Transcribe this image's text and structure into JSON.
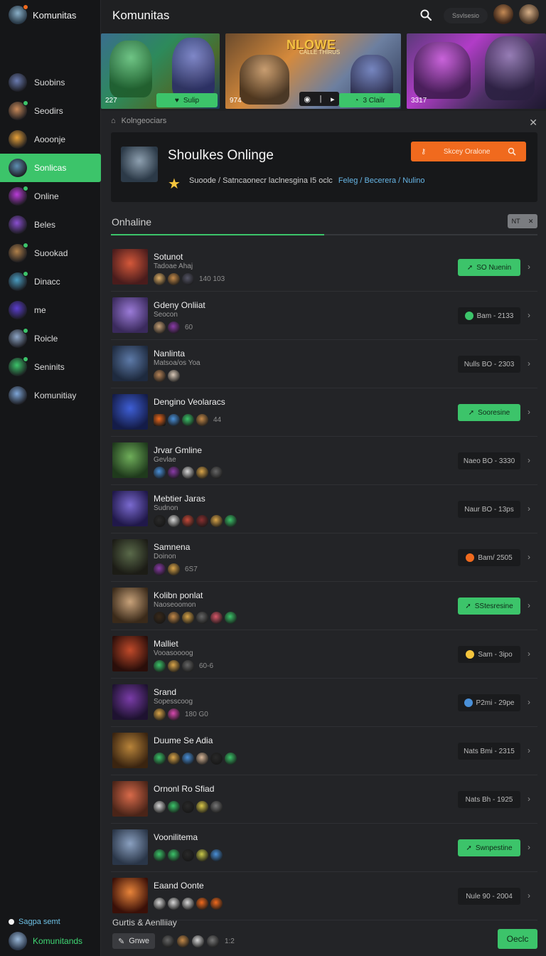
{
  "app": {
    "title": "Komunitas",
    "search_pill": "Ssvlsesio"
  },
  "sidebar": {
    "brand": "Komunitas",
    "items": [
      {
        "label": "Suobins",
        "color": "#6a7bb0",
        "dot": ""
      },
      {
        "label": "Seodirs",
        "color": "#c98a5a",
        "dot": "#3cc46a"
      },
      {
        "label": "Aooonje",
        "color": "#e8a23a",
        "dot": ""
      },
      {
        "label": "Sonlicas",
        "color": "#5f8fb3",
        "dot": ""
      },
      {
        "label": "Online",
        "color": "#b93cd8",
        "dot": "#3cc46a"
      },
      {
        "label": "Beles",
        "color": "#8a4fd0",
        "dot": ""
      },
      {
        "label": "Suookad",
        "color": "#b0804a",
        "dot": "#3cc46a"
      },
      {
        "label": "Dinacc",
        "color": "#4a9cc0",
        "dot": "#3cc46a"
      },
      {
        "label": "me",
        "color": "#5b3ed0",
        "dot": ""
      },
      {
        "label": "Roicle",
        "color": "#8fa7c8",
        "dot": "#3cc46a"
      },
      {
        "label": "Seninits",
        "color": "#3cc46a",
        "dot": "#3cc46a"
      },
      {
        "label": "Komunitiay",
        "color": "#7ea6d8",
        "dot": ""
      }
    ],
    "active_index": 3,
    "footer_link": "Sagpa semt",
    "footer_user": "Komunitands"
  },
  "heroes": [
    {
      "label": "227",
      "button": "Sulip"
    },
    {
      "title": "NLOWE",
      "subtitle": "CALLE THIRUS",
      "label": "974",
      "button": "3 Clailr"
    },
    {
      "label": "3317"
    }
  ],
  "panel": {
    "header": "Kolngeociars",
    "feature": {
      "title": "Shoulkes Onlinge",
      "button": "Skcey Oralone",
      "meta_text": "Suoode / Satncaonecr laclnesgina I5 oclc",
      "meta_link": "Feleg / Becerera / Nulino"
    },
    "section_title": "Onhaline",
    "section_pill": "NT"
  },
  "rows": [
    {
      "name": "Sotunot",
      "sub": "Tadoae Ahaj",
      "count": "140 103",
      "button": "SO Nuenin",
      "style": "green",
      "dot": "",
      "thumb": [
        "#d4583a",
        "#4a1c1c"
      ],
      "icons": [
        "#e0b06a",
        "#c48a4a",
        "#556"
      ]
    },
    {
      "name": "Gdeny Onliiat",
      "sub": "Seocon",
      "count": "60",
      "button": "Bam - 2133",
      "style": "dark",
      "dot": "#3cc46a",
      "thumb": [
        "#9b7bd8",
        "#3a2a5c"
      ],
      "icons": [
        "#c7a27a",
        "#8a3ca8"
      ]
    },
    {
      "name": "Nanlinta",
      "sub": "Matsoa/os Yoa",
      "count": "",
      "button": "Nulls BO - 2303",
      "style": "dark",
      "dot": "",
      "thumb": [
        "#5d7aa8",
        "#1e2a3e"
      ],
      "icons": [
        "#b7855a",
        "#d8c8b8"
      ]
    },
    {
      "name": "Dengino Veolaracs",
      "sub": "",
      "count": "44",
      "button": "Sooresine",
      "style": "green",
      "dot": "",
      "thumb": [
        "#3e5fd6",
        "#141c48"
      ],
      "icons": [
        "#f06a1e",
        "#4a90d8",
        "#3cc46a",
        "#c48a4a"
      ]
    },
    {
      "name": "Jrvar Gmline",
      "sub": "Gevlae",
      "count": "",
      "button": "Naeo BO - 3330",
      "style": "dark",
      "dot": "",
      "thumb": [
        "#6fae5a",
        "#1f3a1c"
      ],
      "icons": [
        "#4a90d8",
        "#8a3ca8",
        "#d8d8d8",
        "#d9a54a",
        "#666"
      ]
    },
    {
      "name": "Mebtier Jaras",
      "sub": "Sudnon",
      "count": "",
      "button": "Naur BO - 13ps",
      "style": "dark",
      "dot": "",
      "thumb": [
        "#7a6ad0",
        "#20184a"
      ],
      "icons": [
        "#2a2a2a",
        "#d8d8d8",
        "#c74a3a",
        "#8a3030",
        "#d9a54a",
        "#3cc46a"
      ]
    },
    {
      "name": "Samnena",
      "sub": "Doinon",
      "count": "6S7",
      "button": "Bam/ 2505",
      "style": "dark",
      "dot": "#f06a1e",
      "thumb": [
        "#5a6a4a",
        "#1c1c16"
      ],
      "icons": [
        "#8a3ca8",
        "#d9a54a"
      ]
    },
    {
      "name": "Kolibn ponlat",
      "sub": "Naoseoomon",
      "count": "",
      "button": "SStesresine",
      "style": "green",
      "dot": "",
      "thumb": [
        "#c8a27a",
        "#3a2a1a"
      ],
      "icons": [
        "#3a2a1a",
        "#c48a4a",
        "#d9a54a",
        "#666",
        "#d8586a",
        "#3cc46a"
      ]
    },
    {
      "name": "Malliet",
      "sub": "Vooasoooog",
      "count": "60-6",
      "button": "Sam - 3ipo",
      "style": "dark",
      "dot": "#f5c53d",
      "thumb": [
        "#c04a2a",
        "#2a0e0a"
      ],
      "icons": [
        "#3cc46a",
        "#d9a54a",
        "#666"
      ]
    },
    {
      "name": "Srand",
      "sub": "Sopesscoog",
      "count": "180 G0",
      "button": "P2mi - 29pe",
      "style": "dark",
      "dot": "#4a90d8",
      "thumb": [
        "#7a3ca8",
        "#1e1230"
      ],
      "icons": [
        "#d9a54a",
        "#d84ab0"
      ]
    },
    {
      "name": "Duume Se Adia",
      "sub": "",
      "count": "",
      "button": "Nats Bmi - 2315",
      "style": "dark",
      "dot": "",
      "thumb": [
        "#b8843a",
        "#3a2410"
      ],
      "icons": [
        "#3cc46a",
        "#d9a54a",
        "#4a90d8",
        "#d8b89a",
        "#2a2a2a",
        "#3cc46a"
      ]
    },
    {
      "name": "Ornonl Ro Sfiad",
      "sub": "",
      "count": "",
      "button": "Nats Bh - 1925",
      "style": "dark",
      "dot": "",
      "thumb": [
        "#d86a4a",
        "#4a2418"
      ],
      "icons": [
        "#d8d8d8",
        "#3cc46a",
        "#2a2a2a",
        "#d9c84a",
        "#777"
      ]
    },
    {
      "name": "Voonilitema",
      "sub": "",
      "count": "",
      "button": "Swnpestine",
      "style": "green",
      "dot": "",
      "thumb": [
        "#8aa0c0",
        "#2a3648"
      ],
      "icons": [
        "#3cc46a",
        "#3cc46a",
        "#2a2a2a",
        "#c8c84a",
        "#4a90d8"
      ]
    },
    {
      "name": "Eaand Oonte",
      "sub": "",
      "count": "",
      "button": "Nule 90 - 2004",
      "style": "dark",
      "dot": "",
      "thumb": [
        "#e8843a",
        "#3a1008"
      ],
      "icons": [
        "#d8d8d8",
        "#d8d8d8",
        "#d8d8d8",
        "#f06a1e",
        "#f06a1e"
      ]
    }
  ],
  "bottom": {
    "title": "Gurtis & Aenlliiay",
    "chip": "Gnwe",
    "count": "1:2",
    "button": "Oeclc",
    "icons": [
      "#666",
      "#c48a4a",
      "#d8d8d8",
      "#777"
    ]
  }
}
